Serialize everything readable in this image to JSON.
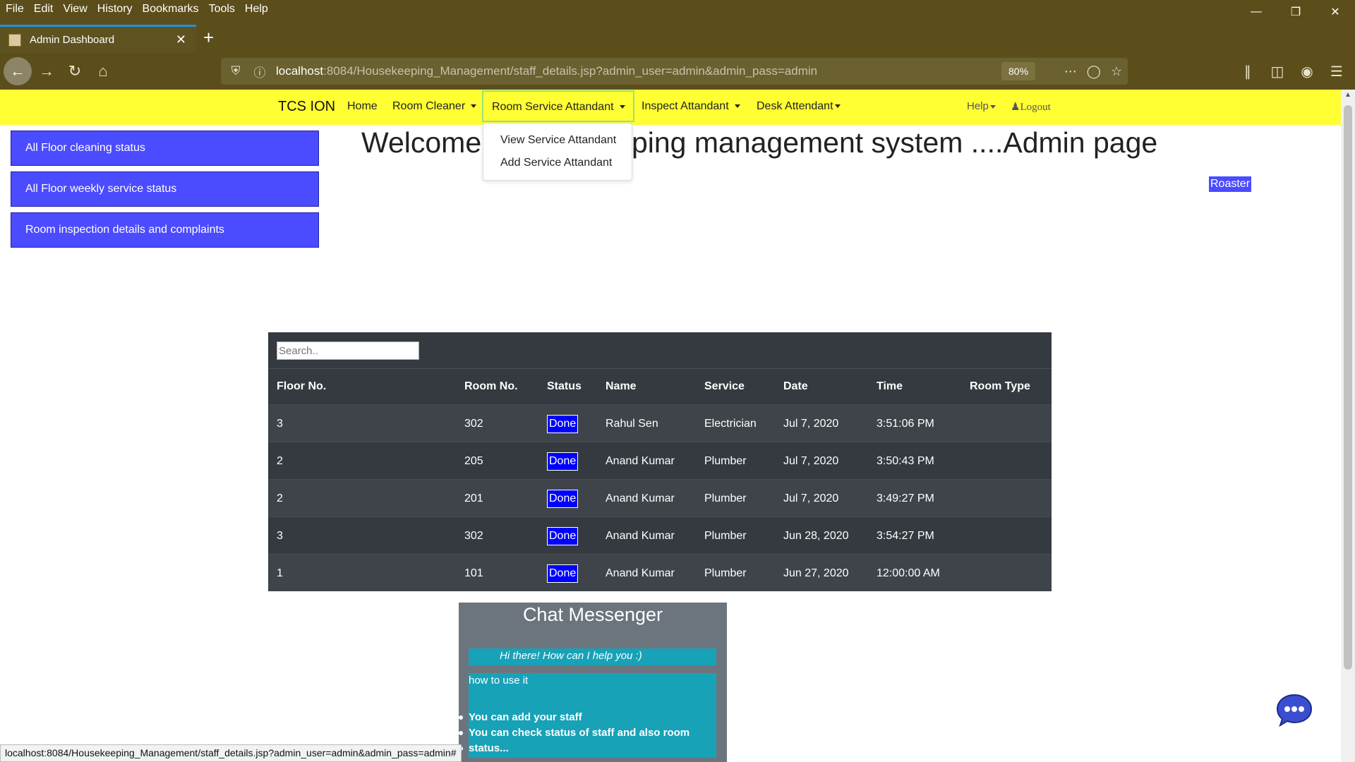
{
  "browser": {
    "menu": [
      "File",
      "Edit",
      "View",
      "History",
      "Bookmarks",
      "Tools",
      "Help"
    ],
    "tab_title": "Admin Dashboard",
    "url_host": "localhost",
    "url_rest": ":8084/Housekeeping_Management/staff_details.jsp?admin_user=admin&admin_pass=admin",
    "zoom": "80%",
    "status_url": "localhost:8084/Housekeeping_Management/staff_details.jsp?admin_user=admin&admin_pass=admin#"
  },
  "site_nav": {
    "brand": "TCS ION",
    "home": "Home",
    "room_cleaner": "Room Cleaner",
    "room_service": "Room Service Attandant",
    "inspect": "Inspect Attandant",
    "desk": "Desk Attendant",
    "help": "Help",
    "logout": "Logout",
    "dropdown": [
      "View Service Attandant",
      "Add Service Attandant"
    ]
  },
  "sidebar": {
    "buttons": [
      "All Floor cleaning status",
      "All Floor weekly service status",
      "Room inspection details and complaints"
    ]
  },
  "welcome_left": "Welcome",
  "welcome_right": "eping management system ....Admin page",
  "roaster": "Roaster",
  "table": {
    "search_placeholder": "Search..",
    "headers": [
      "Floor No.",
      "Room No.",
      "Status",
      "Name",
      "Service",
      "Date",
      "Time",
      "Room Type"
    ],
    "rows": [
      {
        "floor": "3",
        "room": "302",
        "status": "Done",
        "name": "Rahul Sen",
        "service": "Electrician",
        "date": "Jul 7, 2020",
        "time": "3:51:06 PM",
        "type": ""
      },
      {
        "floor": "2",
        "room": "205",
        "status": "Done",
        "name": "Anand Kumar",
        "service": "Plumber",
        "date": "Jul 7, 2020",
        "time": "3:50:43 PM",
        "type": ""
      },
      {
        "floor": "2",
        "room": "201",
        "status": "Done",
        "name": "Anand Kumar",
        "service": "Plumber",
        "date": "Jul 7, 2020",
        "time": "3:49:27 PM",
        "type": ""
      },
      {
        "floor": "3",
        "room": "302",
        "status": "Done",
        "name": "Anand Kumar",
        "service": "Plumber",
        "date": "Jun 28, 2020",
        "time": "3:54:27 PM",
        "type": ""
      },
      {
        "floor": "1",
        "room": "101",
        "status": "Done",
        "name": "Anand Kumar",
        "service": "Plumber",
        "date": "Jun 27, 2020",
        "time": "12:00:00 AM",
        "type": ""
      }
    ]
  },
  "chat": {
    "title": "Chat Messenger",
    "greeting": "Hi there! How can I help you :)",
    "question": "how to use it",
    "answers": [
      "You can add your staff",
      "You can check status of staff and also room",
      "status..."
    ]
  },
  "colors": {
    "browser_frame": "#5c4e1a",
    "site_nav": "#ffff33",
    "sidebar_button": "#4b4bff",
    "table_bg": "#343a40",
    "badge": "#0000ff",
    "chat_bg": "#6c757d",
    "chat_bubble": "#17a2b8"
  }
}
